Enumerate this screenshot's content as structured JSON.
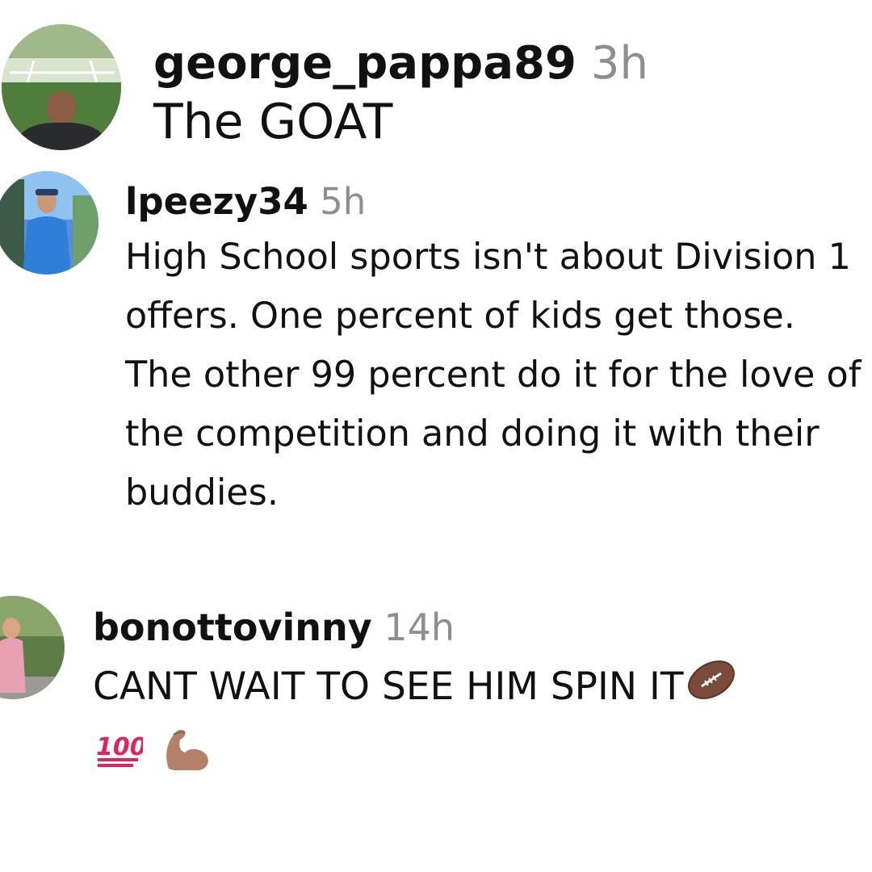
{
  "comments": [
    {
      "username": "george_pappa89",
      "time": "3h",
      "text": "The GOAT",
      "avatar": "profile-photo"
    },
    {
      "username": "lpeezy34",
      "time": "5h",
      "text": "High School sports isn't about Division 1 offers. One percent of kids get those. The other 99 percent do it for the love of the competition and doing it with their buddies.",
      "avatar": "profile-photo"
    },
    {
      "username": "bonottovinny",
      "time": "14h",
      "text": "CANT WAIT TO SEE HIM SPIN IT",
      "avatar": "profile-photo",
      "emojis": [
        "football-emoji",
        "hundred-points-emoji",
        "flexed-biceps-emoji"
      ]
    }
  ],
  "colors": {
    "text": "#111111",
    "timestamp": "#8e8e8e",
    "background": "#ffffff"
  }
}
